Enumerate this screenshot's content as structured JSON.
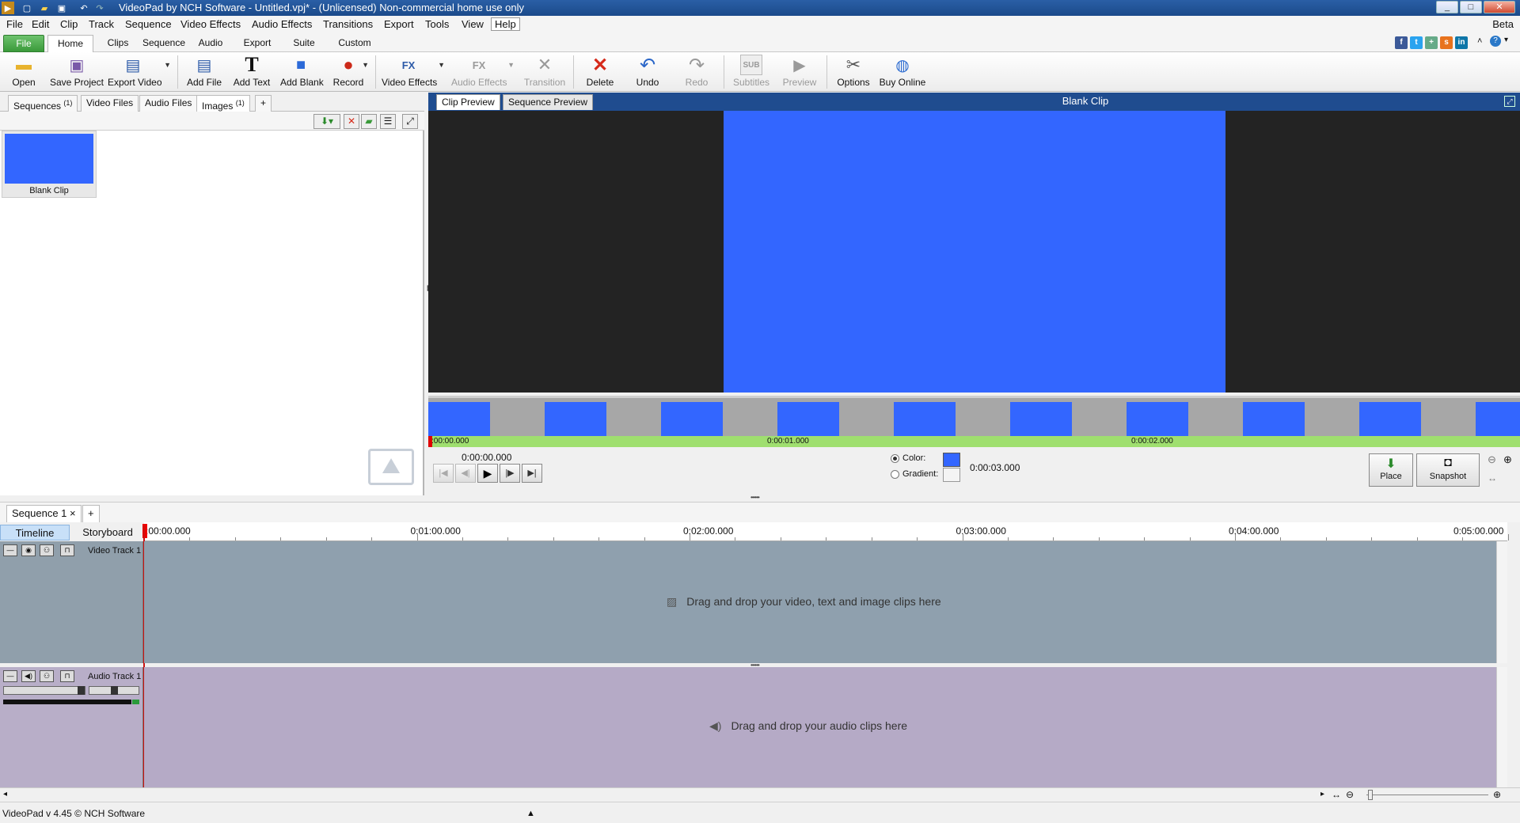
{
  "window": {
    "title": "VideoPad by NCH Software - Untitled.vpj* - (Unlicensed) Non-commercial home use only",
    "min": "0",
    "max": "1",
    "close": "r"
  },
  "menu": {
    "items": [
      "File",
      "Edit",
      "Clip",
      "Track",
      "Sequence",
      "Video Effects",
      "Audio Effects",
      "Transitions",
      "Export",
      "Tools",
      "View",
      "Help"
    ],
    "beta": "Beta"
  },
  "ribbon": {
    "tabs": [
      "File",
      "Home",
      "Clips",
      "Sequence",
      "Audio",
      "Export",
      "Suite",
      "Custom"
    ],
    "active": "Home"
  },
  "toolbar": {
    "open": "Open",
    "save_project": "Save Project",
    "export_video": "Export Video",
    "add_file": "Add File",
    "add_text": "Add Text",
    "add_blank": "Add Blank",
    "record": "Record",
    "video_effects": "Video Effects",
    "audio_effects": "Audio Effects",
    "transition": "Transition",
    "delete": "Delete",
    "undo": "Undo",
    "redo": "Redo",
    "subtitles": "Subtitles",
    "preview": "Preview",
    "options": "Options",
    "buy_online": "Buy Online"
  },
  "bin": {
    "tabs": [
      {
        "label": "Sequences",
        "count": "(1)"
      },
      {
        "label": "Video Files",
        "count": ""
      },
      {
        "label": "Audio Files",
        "count": ""
      },
      {
        "label": "Images",
        "count": "(1)"
      }
    ],
    "add_tab": "+",
    "clip_name": "Blank Clip"
  },
  "preview": {
    "tabs": [
      "Clip Preview",
      "Sequence Preview"
    ],
    "title": "Blank Clip",
    "clip_color": "#3366ff",
    "scrub_times": [
      ":00:00.000",
      "0:00:01.000",
      "0:00:02.000"
    ],
    "current_time": "0:00:00.000",
    "color_label": "Color:",
    "gradient_label": "Gradient:",
    "duration": "0:00:03.000",
    "place": "Place",
    "snapshot": "Snapshot"
  },
  "sequence": {
    "tab": "Sequence 1",
    "close": "×",
    "add": "+",
    "timeline": "Timeline",
    "storyboard": "Storyboard",
    "ruler": ":00:00.000|0:01:00.000|0:02:00.000|0:03:00.000|0:04:00.000|0:05:00.000",
    "video_track": "Video Track 1",
    "audio_track": "Audio Track 1",
    "video_hint": "Drag and drop your video, text and image clips here",
    "audio_hint": "Drag and drop your audio clips here"
  },
  "status": {
    "text": "VideoPad v 4.45 © NCH Software"
  }
}
